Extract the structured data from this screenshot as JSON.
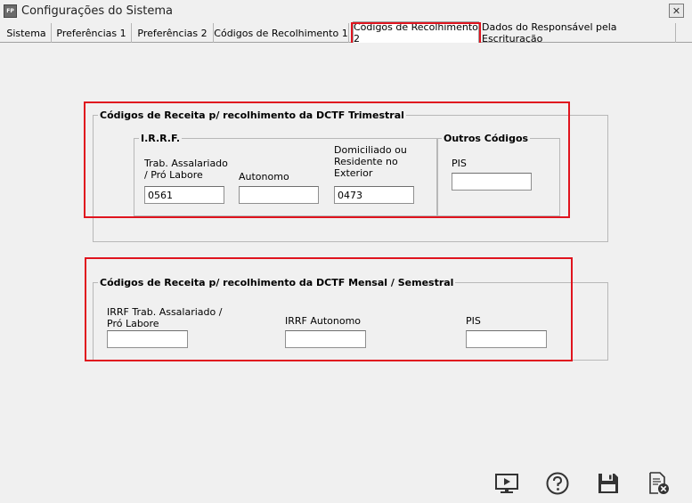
{
  "window": {
    "icon_text": "FP",
    "title": "Configurações do Sistema",
    "close_glyph": "✕"
  },
  "tabs": [
    {
      "label": "Sistema"
    },
    {
      "label": "Preferências 1"
    },
    {
      "label": "Preferências 2"
    },
    {
      "label": "Códigos de Recolhimento 1"
    },
    {
      "label": "Códigos de Recolhimento 2",
      "active": true
    },
    {
      "label": "Dados do Responsável pela Escrituração"
    }
  ],
  "trimestral": {
    "title": "Códigos de Receita p/ recolhimento da DCTF Trimestral",
    "irrf": {
      "title": "I.R.R.F.",
      "assalariado_label": "Trab. Assalariado / Pró Labore",
      "assalariado_value": "0561",
      "autonomo_label": "Autonomo",
      "autonomo_value": "",
      "exterior_label": "Domiciliado ou Residente no Exterior",
      "exterior_value": "0473"
    },
    "outros": {
      "title": "Outros Códigos",
      "pis_label": "PIS",
      "pis_value": ""
    }
  },
  "mensal": {
    "title": "Códigos de Receita p/ recolhimento da DCTF Mensal / Semestral",
    "assalariado_label": "IRRF Trab. Assalariado / Pró Labore",
    "assalariado_value": "",
    "autonomo_label": "IRRF Autonomo",
    "autonomo_value": "",
    "pis_label": "PIS",
    "pis_value": ""
  },
  "toolbar": {
    "buttons": [
      {
        "icon": "monitor-play-icon"
      },
      {
        "icon": "help-icon"
      },
      {
        "icon": "save-icon"
      },
      {
        "icon": "close-document-icon"
      }
    ]
  },
  "colors": {
    "highlight": "#e0141e",
    "background": "#f0f0f0"
  }
}
